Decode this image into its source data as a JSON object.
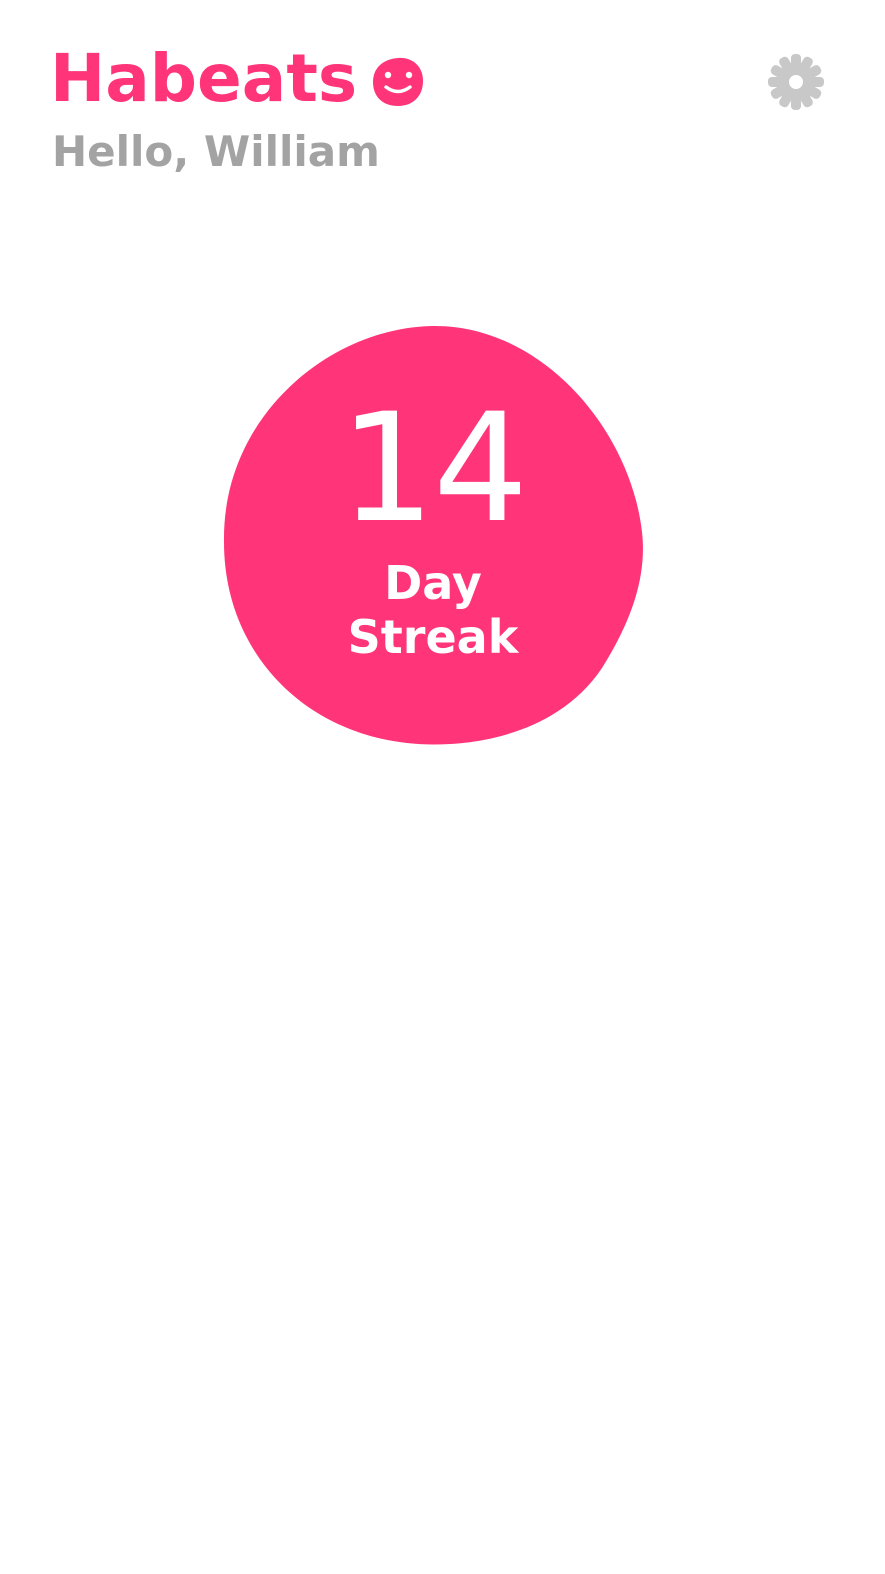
{
  "app": {
    "title": "Habeats",
    "logo_icon": "smiley-face-icon",
    "greeting": "Hello, William"
  },
  "header": {
    "settings_icon": "gear-icon"
  },
  "streak": {
    "count": "14",
    "label_line1": "Day",
    "label_line2": "Streak"
  },
  "colors": {
    "brand": "#ff3479",
    "greeting_text": "#a3a3a3",
    "settings_icon": "#c8c8c8",
    "background": "#ffffff",
    "streak_text": "#ffffff"
  }
}
